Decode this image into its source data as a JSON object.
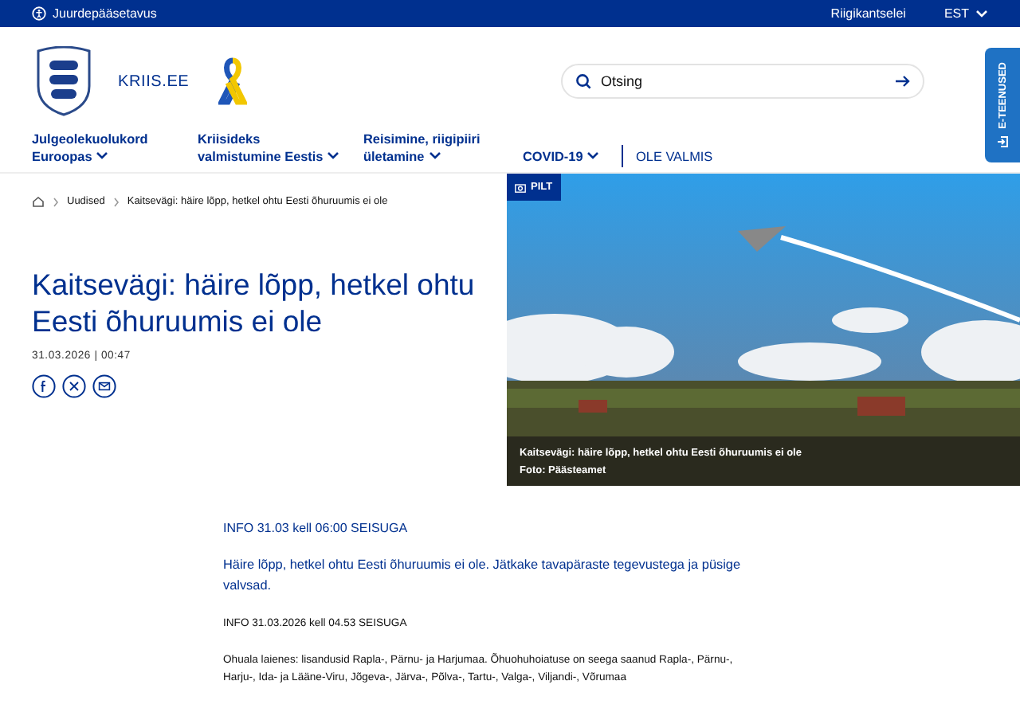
{
  "top_bar": {
    "accessibility": "Juurdepääsetavus",
    "link": "Riigikantselei",
    "language": "EST"
  },
  "header": {
    "site_name": "KRIIS.EE",
    "search": {
      "placeholder": "Otsing"
    },
    "side_tab": "E-TEENUSED"
  },
  "nav": [
    {
      "label": "Julgeolekuolukord Euroopas",
      "kind": "dropdown"
    },
    {
      "label": "Kriisideks valmistumine Eestis",
      "kind": "dropdown"
    },
    {
      "label": "Reisimine, riigipiiri ületamine",
      "kind": "dropdown"
    },
    {
      "label": "COVID-19",
      "kind": "dropdown"
    },
    {
      "label": "OLE VALMIS",
      "kind": "link"
    }
  ],
  "breadcrumb": [
    "Uudised",
    "Kaitsevägi: häire lõpp, hetkel ohtu Eesti õhuruumis ei ole"
  ],
  "article": {
    "title": "Kaitsevägi: häire lõpp, hetkel ohtu Eesti õhuruumis ei ole",
    "date": "31.03.2026 | 00:47",
    "image": {
      "badge": "PILT",
      "caption": "Kaitsevägi: häire lõpp, hetkel ohtu Eesti õhuruumis ei ole",
      "credit": "Foto: Päästeamet"
    },
    "body": [
      {
        "kind": "heading",
        "text": "INFO 31.03 kell 06:00 SEISUGA"
      },
      {
        "kind": "lead",
        "text": "Häire lõpp, hetkel ohtu Eesti õhuruumis ei ole. Jätkake tavapäraste tegevustega ja püsige valvsad."
      },
      {
        "kind": "subheading",
        "text": "INFO 31.03.2026 kell 04.53 SEISUGA"
      },
      {
        "kind": "paragraph",
        "text": "Ohuala laienes: lisandusid Rapla-, Pärnu- ja Harjumaa. Õhuohuhoiatuse on seega saanud Rapla-, Pärnu-, Harju-, Ida- ja Lääne-Viru, Jõgeva-, Järva-, Põlva-, Tartu-, Valga-, Viljandi-, Võrumaa"
      }
    ]
  }
}
